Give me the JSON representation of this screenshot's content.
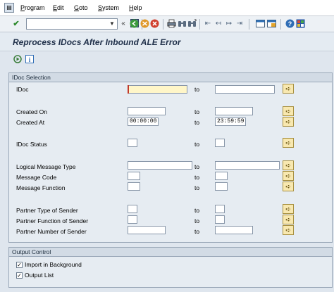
{
  "menu": {
    "items": [
      "Program",
      "Edit",
      "Goto",
      "System",
      "Help"
    ]
  },
  "toolbar": {
    "command_value": "",
    "icons": [
      "checkmark-icon",
      "save-icon",
      "back-icon",
      "exit-icon",
      "cancel-icon",
      "print-icon",
      "find-icon",
      "find-next-icon",
      "first-page-icon",
      "prev-page-icon",
      "next-page-icon",
      "last-page-icon",
      "new-session-icon",
      "shortcut-icon",
      "help-icon",
      "layout-icon"
    ]
  },
  "page": {
    "title": "Reprocess IDocs After Inbound ALE Error"
  },
  "idoc_selection": {
    "title": "IDoc Selection",
    "to_label": "to",
    "rows": [
      {
        "label": "IDoc",
        "from": "",
        "to": ""
      },
      {
        "label": "Created On",
        "from": "",
        "to": ""
      },
      {
        "label": "Created At",
        "from": "00:00:00",
        "to": "23:59:59"
      },
      {
        "label": "IDoc Status",
        "from": "",
        "to": ""
      },
      {
        "label": "Logical Message Type",
        "from": "",
        "to": ""
      },
      {
        "label": "Message Code",
        "from": "",
        "to": ""
      },
      {
        "label": "Message Function",
        "from": "",
        "to": ""
      },
      {
        "label": "Partner Type of Sender",
        "from": "",
        "to": ""
      },
      {
        "label": "Partner Function of Sender",
        "from": "",
        "to": ""
      },
      {
        "label": "Partner Number of Sender",
        "from": "",
        "to": ""
      }
    ]
  },
  "output_control": {
    "title": "Output Control",
    "options": [
      {
        "label": "Import in Background",
        "checked": true,
        "mark": "✓"
      },
      {
        "label": "Output List",
        "checked": true,
        "mark": "✓"
      }
    ]
  }
}
